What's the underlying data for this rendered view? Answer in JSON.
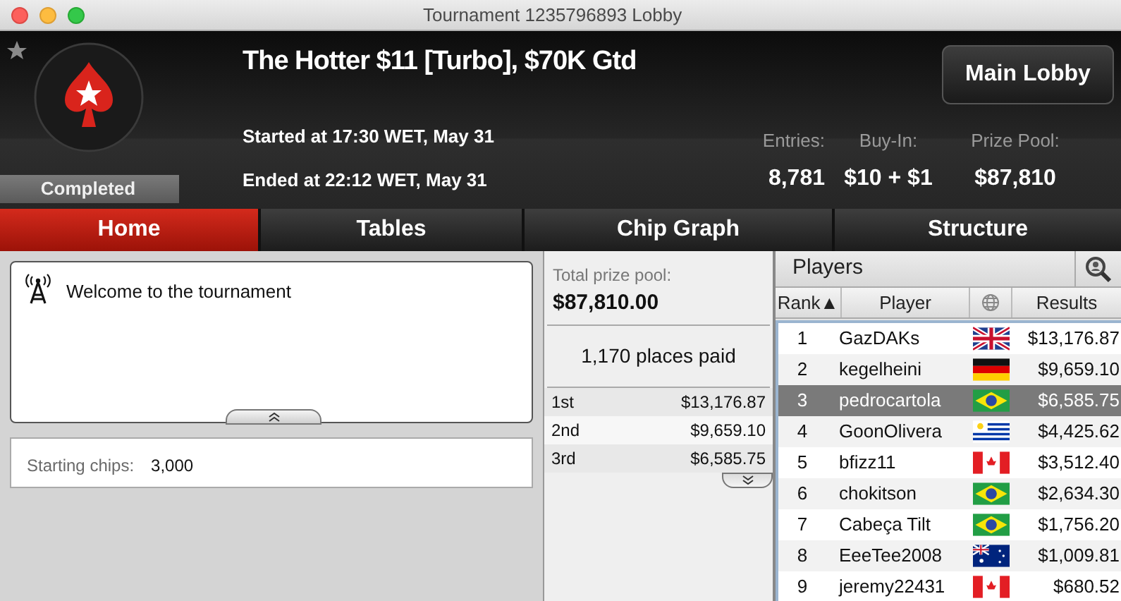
{
  "window": {
    "title": "Tournament 1235796893 Lobby"
  },
  "header": {
    "title": "The Hotter $11 [Turbo], $70K Gtd",
    "status": "Completed",
    "started": "Started at 17:30 WET, May 31",
    "ended": "Ended at 22:12 WET, May 31",
    "main_lobby_button": "Main Lobby",
    "stats": [
      {
        "label": "Entries:",
        "value": "8,781"
      },
      {
        "label": "Buy-In:",
        "value": "$10 + $1"
      },
      {
        "label": "Prize Pool:",
        "value": "$87,810"
      }
    ]
  },
  "tabs": [
    {
      "label": "Home",
      "selected": true
    },
    {
      "label": "Tables",
      "selected": false
    },
    {
      "label": "Chip Graph",
      "selected": false
    },
    {
      "label": "Structure",
      "selected": false
    }
  ],
  "messages": {
    "text": "Welcome to the tournament"
  },
  "info": {
    "label": "Starting chips:",
    "value": "3,000"
  },
  "prizes": {
    "total_label": "Total prize pool:",
    "total": "$87,810.00",
    "places_paid": "1,170 places paid",
    "rows": [
      {
        "place": "1st",
        "amount": "$13,176.87"
      },
      {
        "place": "2nd",
        "amount": "$9,659.10"
      },
      {
        "place": "3rd",
        "amount": "$6,585.75"
      }
    ]
  },
  "players": {
    "title": "Players",
    "columns": [
      "Rank▲",
      "Player",
      "Results"
    ],
    "rows": [
      {
        "rank": "1",
        "name": "GazDAKs",
        "kind": "gb",
        "result": "$13,176.87",
        "selected": false
      },
      {
        "rank": "2",
        "name": "kegelheini",
        "kind": "de",
        "result": "$9,659.10",
        "selected": false
      },
      {
        "rank": "3",
        "name": "pedrocartola",
        "kind": "br",
        "result": "$6,585.75",
        "selected": true
      },
      {
        "rank": "4",
        "name": "GoonOlivera",
        "kind": "uy",
        "result": "$4,425.62",
        "selected": false
      },
      {
        "rank": "5",
        "name": "bfizz11",
        "kind": "ca",
        "result": "$3,512.40",
        "selected": false
      },
      {
        "rank": "6",
        "name": "chokitson",
        "kind": "br",
        "result": "$2,634.30",
        "selected": false
      },
      {
        "rank": "7",
        "name": "Cabeça Tilt",
        "kind": "br",
        "result": "$1,756.20",
        "selected": false
      },
      {
        "rank": "8",
        "name": "EeeTee2008",
        "kind": "au",
        "result": "$1,009.81",
        "selected": false
      },
      {
        "rank": "9",
        "name": "jeremy22431",
        "kind": "ca",
        "result": "$680.52",
        "selected": false
      }
    ]
  }
}
